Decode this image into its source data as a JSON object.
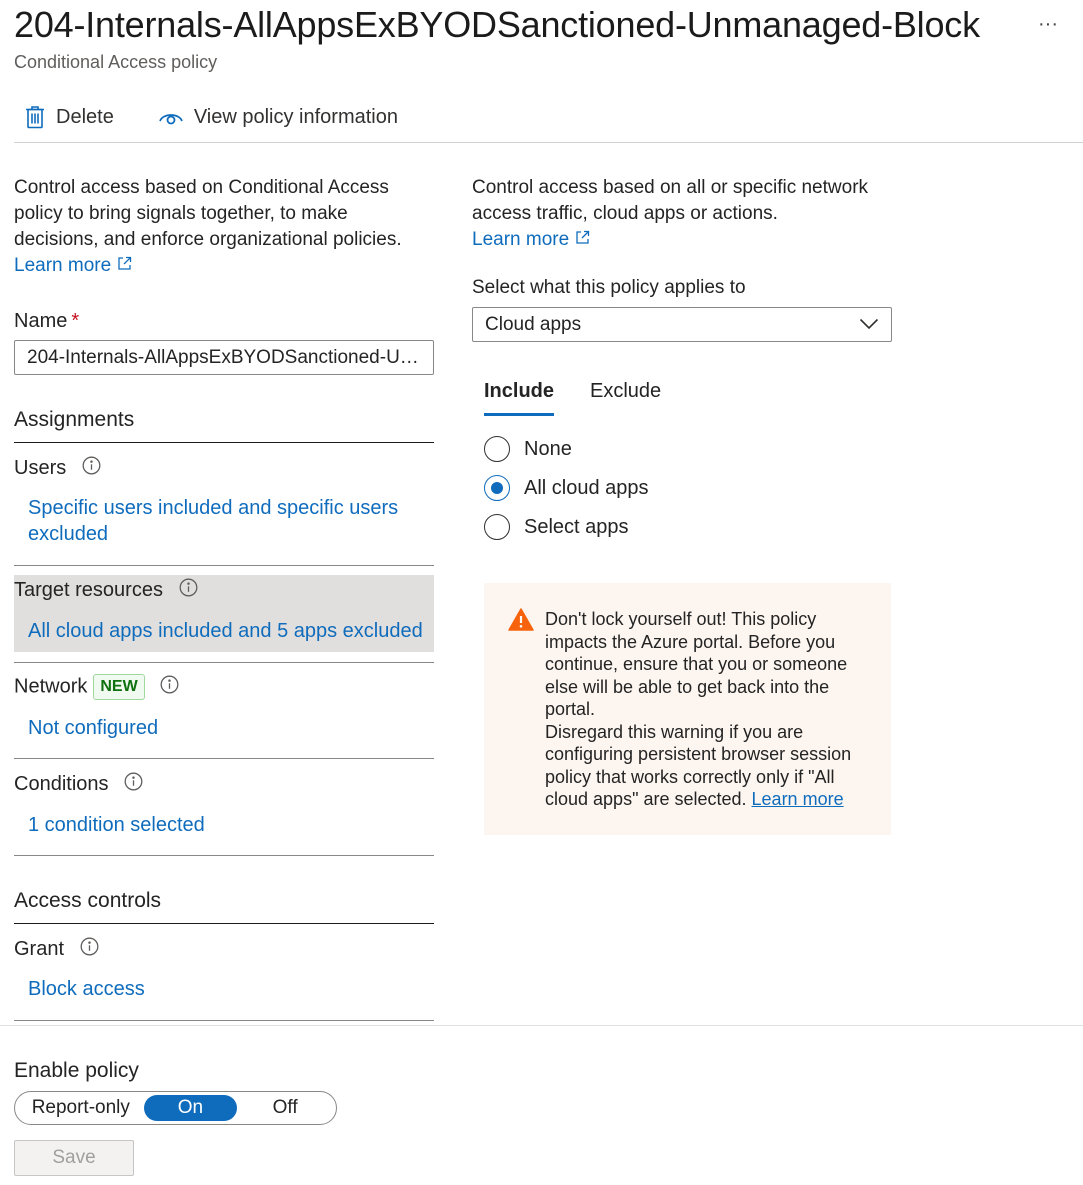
{
  "header": {
    "title": "204-Internals-AllAppsExBYODSanctioned-Unmanaged-Block",
    "subtitle": "Conditional Access policy",
    "more_label": "···"
  },
  "toolbar": {
    "delete_label": "Delete",
    "delete_icon": "trash-icon",
    "view_label": "View policy information",
    "view_icon": "eye-icon"
  },
  "left": {
    "intro": "Control access based on Conditional Access policy to bring signals together, to make decisions, and enforce organizational policies.",
    "learn_more": "Learn more",
    "name_label": "Name",
    "name_required": "*",
    "name_value": "204-Internals-AllAppsExBYODSanctioned-Unmanaged-Block",
    "assignments_title": "Assignments",
    "users_label": "Users",
    "users_link": "Specific users included and specific users excluded",
    "target_label": "Target resources",
    "target_link": "All cloud apps included and 5 apps excluded",
    "network_label": "Network",
    "network_badge": "NEW",
    "network_link": "Not configured",
    "conditions_label": "Conditions",
    "conditions_link": "1 condition selected",
    "access_title": "Access controls",
    "grant_label": "Grant",
    "grant_link": "Block access"
  },
  "right": {
    "intro": "Control access based on all or specific network access traffic, cloud apps or actions.",
    "learn_more": "Learn more",
    "applies_label": "Select what this policy applies to",
    "applies_value": "Cloud apps",
    "tabs": [
      {
        "label": "Include",
        "active": true
      },
      {
        "label": "Exclude",
        "active": false
      }
    ],
    "radios": [
      {
        "label": "None",
        "checked": false
      },
      {
        "label": "All cloud apps",
        "checked": true
      },
      {
        "label": "Select apps",
        "checked": false
      }
    ],
    "warning": {
      "icon": "warning-icon",
      "line1": "Don't lock yourself out! This policy impacts the Azure portal. Before you continue, ensure that you or someone else will be able to get back into the portal.",
      "line2": "Disregard this warning if you are configuring persistent browser session policy that works correctly only if \"All cloud apps\" are selected.",
      "learn_more": "Learn more",
      "bg_color": "#fdf6f0",
      "icon_color": "#f7630c"
    }
  },
  "footer": {
    "enable_label": "Enable policy",
    "options": [
      {
        "label": "Report-only",
        "selected": false
      },
      {
        "label": "On",
        "selected": true
      },
      {
        "label": "Off",
        "selected": false
      }
    ],
    "save_label": "Save"
  },
  "colors": {
    "accent": "#0f6cbd",
    "required": "#c50f1f",
    "badge_text": "#0e700e",
    "selected_row_bg": "#e1dfdd"
  }
}
